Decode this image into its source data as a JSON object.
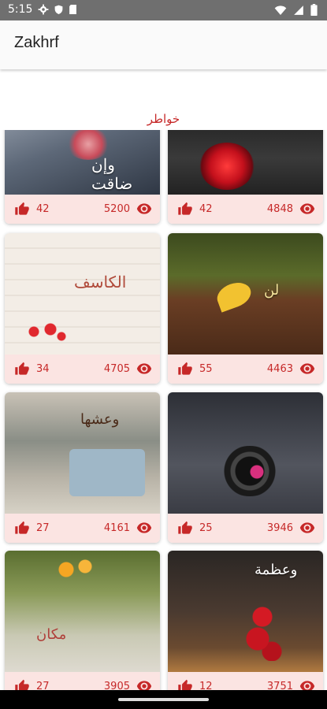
{
  "status_bar": {
    "time": "5:15"
  },
  "app": {
    "title": "Zakhrf"
  },
  "section": {
    "title": "خواطر"
  },
  "cards": [
    {
      "likes": "42",
      "views": "5200"
    },
    {
      "likes": "42",
      "views": "4848"
    },
    {
      "likes": "34",
      "views": "4705"
    },
    {
      "likes": "55",
      "views": "4463"
    },
    {
      "likes": "27",
      "views": "4161"
    },
    {
      "likes": "25",
      "views": "3946"
    },
    {
      "likes": "27",
      "views": "3905"
    },
    {
      "likes": "12",
      "views": "3751"
    }
  ],
  "colors": {
    "accent": "#c62828",
    "card_bar": "#fbe4e2",
    "status_bar": "#6f6f6f"
  }
}
